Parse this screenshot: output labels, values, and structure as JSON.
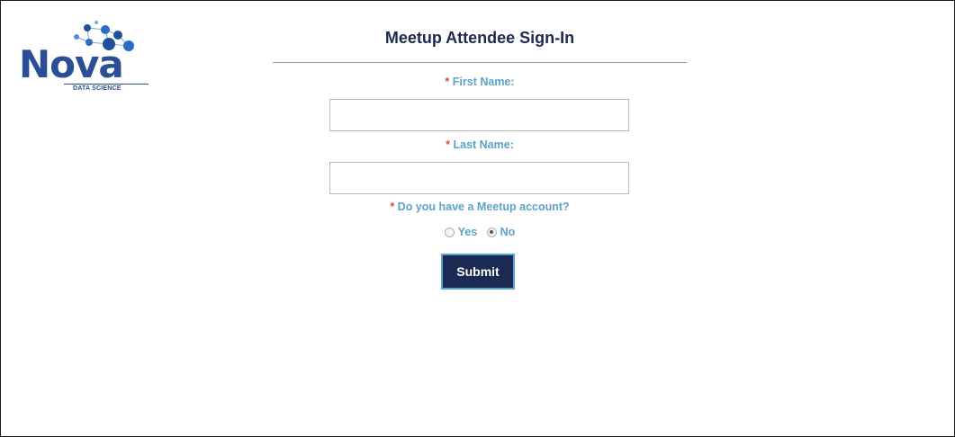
{
  "logo": {
    "name": "Nova",
    "subtitle": "DATA SCIENCE"
  },
  "form": {
    "title": "Meetup Attendee Sign-In",
    "required_marker": "*",
    "first_name": {
      "label": "First Name:",
      "value": ""
    },
    "last_name": {
      "label": "Last Name:",
      "value": ""
    },
    "meetup_account": {
      "question": "Do you have a Meetup account?",
      "options": [
        "Yes",
        "No"
      ],
      "selected": "No"
    },
    "submit_label": "Submit"
  },
  "colors": {
    "title": "#1c2a4d",
    "label": "#5ba3c9",
    "required": "#d44a4a",
    "button_bg": "#1a2a52",
    "button_border": "#5ba3c9",
    "logo": "#2b4f95"
  }
}
